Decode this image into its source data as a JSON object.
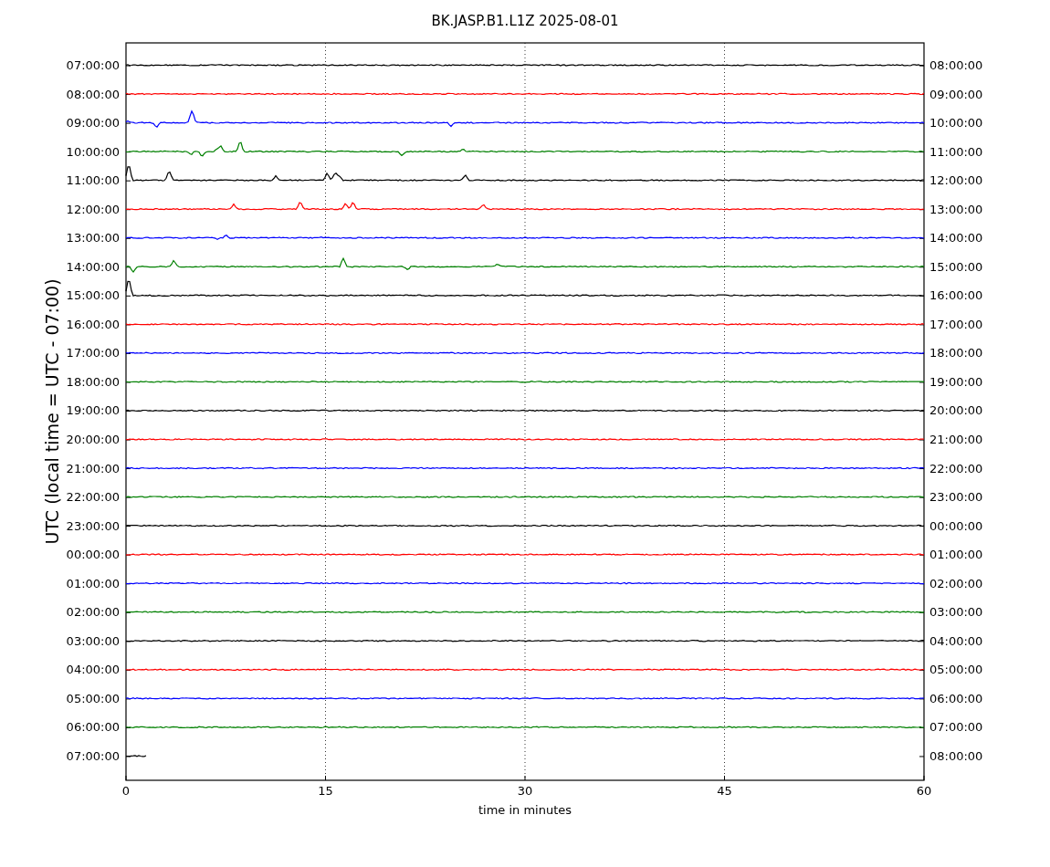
{
  "title": "BK.JASP.B1.L1Z 2025-08-01",
  "y_label": "UTC (local time = UTC - 07:00)",
  "x_label": "time in minutes",
  "x_ticks": [
    "0",
    "15",
    "30",
    "45",
    "60"
  ],
  "rows": [
    {
      "left": "07:00:00",
      "right": "08:00:00",
      "color": "#000000",
      "kind": "full"
    },
    {
      "left": "08:00:00",
      "right": "09:00:00",
      "color": "#ff0000",
      "kind": "full"
    },
    {
      "left": "09:00:00",
      "right": "10:00:00",
      "color": "#0000ff",
      "kind": "full"
    },
    {
      "left": "10:00:00",
      "right": "11:00:00",
      "color": "#008000",
      "kind": "full"
    },
    {
      "left": "11:00:00",
      "right": "12:00:00",
      "color": "#000000",
      "kind": "full"
    },
    {
      "left": "12:00:00",
      "right": "13:00:00",
      "color": "#ff0000",
      "kind": "full"
    },
    {
      "left": "13:00:00",
      "right": "14:00:00",
      "color": "#0000ff",
      "kind": "full"
    },
    {
      "left": "14:00:00",
      "right": "15:00:00",
      "color": "#008000",
      "kind": "full"
    },
    {
      "left": "15:00:00",
      "right": "16:00:00",
      "color": "#000000",
      "kind": "full"
    },
    {
      "left": "16:00:00",
      "right": "17:00:00",
      "color": "#ff0000",
      "kind": "full"
    },
    {
      "left": "17:00:00",
      "right": "18:00:00",
      "color": "#0000ff",
      "kind": "full"
    },
    {
      "left": "18:00:00",
      "right": "19:00:00",
      "color": "#008000",
      "kind": "full"
    },
    {
      "left": "19:00:00",
      "right": "20:00:00",
      "color": "#000000",
      "kind": "full"
    },
    {
      "left": "20:00:00",
      "right": "21:00:00",
      "color": "#ff0000",
      "kind": "full"
    },
    {
      "left": "21:00:00",
      "right": "22:00:00",
      "color": "#0000ff",
      "kind": "full"
    },
    {
      "left": "22:00:00",
      "right": "23:00:00",
      "color": "#008000",
      "kind": "full"
    },
    {
      "left": "23:00:00",
      "right": "00:00:00",
      "color": "#000000",
      "kind": "full"
    },
    {
      "left": "00:00:00",
      "right": "01:00:00",
      "color": "#ff0000",
      "kind": "full"
    },
    {
      "left": "01:00:00",
      "right": "02:00:00",
      "color": "#0000ff",
      "kind": "full"
    },
    {
      "left": "02:00:00",
      "right": "03:00:00",
      "color": "#008000",
      "kind": "full"
    },
    {
      "left": "03:00:00",
      "right": "04:00:00",
      "color": "#000000",
      "kind": "full"
    },
    {
      "left": "04:00:00",
      "right": "05:00:00",
      "color": "#ff0000",
      "kind": "full"
    },
    {
      "left": "05:00:00",
      "right": "06:00:00",
      "color": "#0000ff",
      "kind": "full"
    },
    {
      "left": "06:00:00",
      "right": "07:00:00",
      "color": "#008000",
      "kind": "full"
    },
    {
      "left": "07:00:00",
      "right": "08:00:00",
      "color": "#000000",
      "kind": "partial"
    }
  ]
}
